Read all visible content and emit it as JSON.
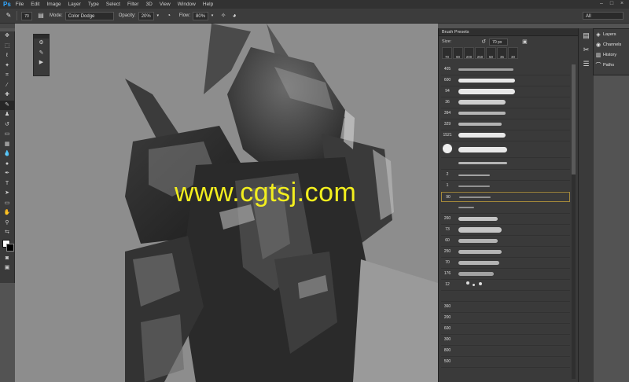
{
  "app": {
    "logo": "Ps"
  },
  "menubar": {
    "items": [
      "File",
      "Edit",
      "Image",
      "Layer",
      "Type",
      "Select",
      "Filter",
      "3D",
      "View",
      "Window",
      "Help"
    ],
    "controls": {
      "minimize": "–",
      "maximize": "□",
      "close": "×"
    }
  },
  "options_bar": {
    "brush_size": "70",
    "mode_label": "Mode:",
    "mode_value": "Color Dodge",
    "opacity_label": "Opacity:",
    "opacity_value": "20%",
    "flow_label": "Flow:",
    "flow_value": "80%",
    "workspace": "All"
  },
  "watermark": "www.cgtsj.com",
  "brush_presets": {
    "title": "Brush Presets",
    "size_label": "Size:",
    "size_value": "70 px",
    "thumb_sizes": [
      "70",
      "90",
      "200",
      "250",
      "50",
      "35",
      "30"
    ],
    "brush_numbers": [
      "405",
      "600",
      "94",
      "36",
      "394",
      "329",
      "1521",
      "",
      "2",
      "1",
      "90",
      "",
      "260",
      "73",
      "60",
      "250",
      "70",
      "176",
      "12",
      "",
      "360",
      "200",
      "600",
      "300",
      "800",
      "500"
    ]
  },
  "right_panels": {
    "items": [
      {
        "label": "Layers",
        "icon": "layers-icon"
      },
      {
        "label": "Channels",
        "icon": "channels-icon"
      },
      {
        "label": "History",
        "icon": "history-icon"
      },
      {
        "label": "Paths",
        "icon": "paths-icon"
      }
    ]
  }
}
